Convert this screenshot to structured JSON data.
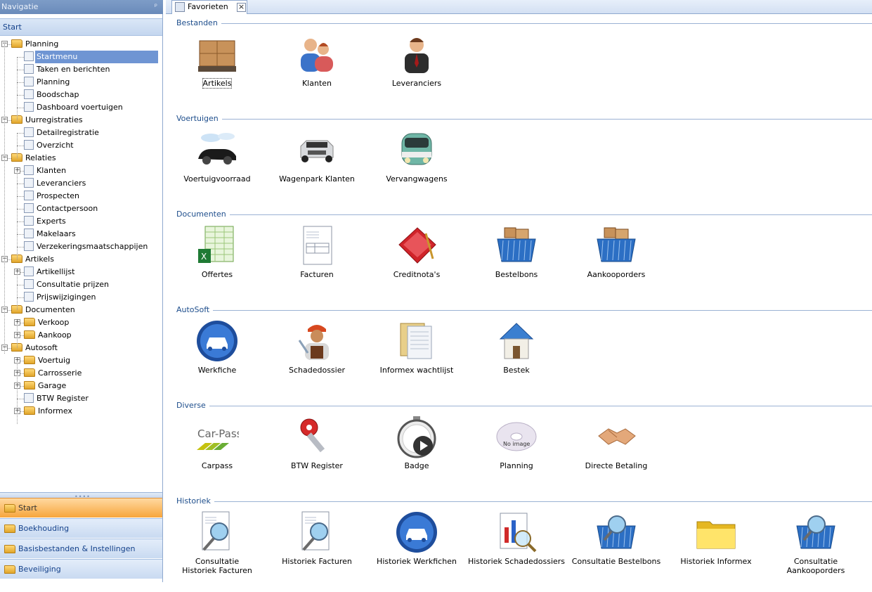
{
  "nav": {
    "title": "Navigatie",
    "pin": "ᵖ",
    "section": "Start",
    "tree": [
      {
        "label": "Planning",
        "type": "folder",
        "expanded": true
      },
      {
        "label": "Startmenu",
        "type": "leaf",
        "selected": true
      },
      {
        "label": "Taken en berichten",
        "type": "leaf"
      },
      {
        "label": "Planning",
        "type": "leaf"
      },
      {
        "label": "Boodschap",
        "type": "leaf"
      },
      {
        "label": "Dashboard voertuigen",
        "type": "leaf"
      },
      {
        "label": "Uurregistraties",
        "type": "folder",
        "expanded": true
      },
      {
        "label": "Detailregistratie",
        "type": "leaf"
      },
      {
        "label": "Overzicht",
        "type": "leaf"
      },
      {
        "label": "Relaties",
        "type": "folder",
        "expanded": true
      },
      {
        "label": "Klanten",
        "type": "leaf"
      },
      {
        "label": "Leveranciers",
        "type": "leaf"
      },
      {
        "label": "Prospecten",
        "type": "leaf"
      },
      {
        "label": "Contactpersoon",
        "type": "leaf"
      },
      {
        "label": "Experts",
        "type": "leaf"
      },
      {
        "label": "Makelaars",
        "type": "leaf"
      },
      {
        "label": "Verzekeringsmaatschappijen",
        "type": "leaf"
      },
      {
        "label": "Artikels",
        "type": "folder",
        "expanded": true
      },
      {
        "label": "Artikellijst",
        "type": "leaf"
      },
      {
        "label": "Consultatie prijzen",
        "type": "leaf"
      },
      {
        "label": "Prijswijzigingen",
        "type": "leaf"
      },
      {
        "label": "Documenten",
        "type": "folder",
        "expanded": true
      },
      {
        "label": "Verkoop",
        "type": "folder",
        "expanded": false
      },
      {
        "label": "Aankoop",
        "type": "folder",
        "expanded": false
      },
      {
        "label": "Autosoft",
        "type": "folder",
        "expanded": true
      },
      {
        "label": "Voertuig",
        "type": "folder",
        "expanded": false
      },
      {
        "label": "Carrosserie",
        "type": "folder",
        "expanded": false
      },
      {
        "label": "Garage",
        "type": "folder",
        "expanded": false
      },
      {
        "label": "BTW Register",
        "type": "leaf"
      },
      {
        "label": "Informex",
        "type": "folder",
        "expanded": false
      }
    ],
    "buttons": [
      {
        "label": "Start",
        "active": true
      },
      {
        "label": "Boekhouding",
        "active": false
      },
      {
        "label": "Basisbestanden & Instellingen",
        "active": false
      },
      {
        "label": "Beveiliging",
        "active": false
      }
    ]
  },
  "tab": {
    "label": "Favorieten",
    "close": "×"
  },
  "groups": [
    {
      "title": "Bestanden",
      "items": [
        {
          "label": "Artikels",
          "icon": "pallet-boxes-icon"
        },
        {
          "label": "Klanten",
          "icon": "customers-icon"
        },
        {
          "label": "Leveranciers",
          "icon": "supplier-icon"
        }
      ]
    },
    {
      "title": "Voertuigen",
      "items": [
        {
          "label": "Voertuigvoorraad",
          "icon": "black-car-icon"
        },
        {
          "label": "Wagenpark Klanten",
          "icon": "silver-car-icon"
        },
        {
          "label": "Vervangwagens",
          "icon": "van-icon"
        }
      ]
    },
    {
      "title": "Documenten",
      "items": [
        {
          "label": "Offertes",
          "icon": "spreadsheet-icon"
        },
        {
          "label": "Facturen",
          "icon": "invoice-icon"
        },
        {
          "label": "Creditnota's",
          "icon": "credit-note-icon"
        },
        {
          "label": "Bestelbons",
          "icon": "basket-icon"
        },
        {
          "label": "Aankooporders",
          "icon": "basket-icon"
        }
      ]
    },
    {
      "title": "AutoSoft",
      "items": [
        {
          "label": "Werkfiche",
          "icon": "car-badge-icon"
        },
        {
          "label": "Schadedossier",
          "icon": "mechanic-icon"
        },
        {
          "label": "Informex wachtlijst",
          "icon": "files-icon"
        },
        {
          "label": "Bestek",
          "icon": "house-icon"
        }
      ]
    },
    {
      "title": "Diverse",
      "items": [
        {
          "label": "Carpass",
          "icon": "carpass-logo-icon",
          "logo": "Car-Pass"
        },
        {
          "label": "BTW Register",
          "icon": "key-icon"
        },
        {
          "label": "Badge",
          "icon": "stopwatch-icon"
        },
        {
          "label": "Planning",
          "icon": "no-image-icon",
          "note": "No image"
        },
        {
          "label": "Directe Betaling",
          "icon": "handshake-icon"
        }
      ]
    },
    {
      "title": "Historiek",
      "items": [
        {
          "label": "Consultatie Historiek Facturen",
          "icon": "invoice-search-icon"
        },
        {
          "label": "Historiek Facturen",
          "icon": "invoice-search-icon"
        },
        {
          "label": "Historiek Werkfichen",
          "icon": "car-badge-icon"
        },
        {
          "label": "Historiek Schadedossiers",
          "icon": "chart-search-icon"
        },
        {
          "label": "Consultatie Bestelbons",
          "icon": "basket-search-icon"
        },
        {
          "label": "Historiek Informex",
          "icon": "folder-icon"
        },
        {
          "label": "Consultatie Aankooporders",
          "icon": "basket-search-icon"
        }
      ]
    }
  ]
}
